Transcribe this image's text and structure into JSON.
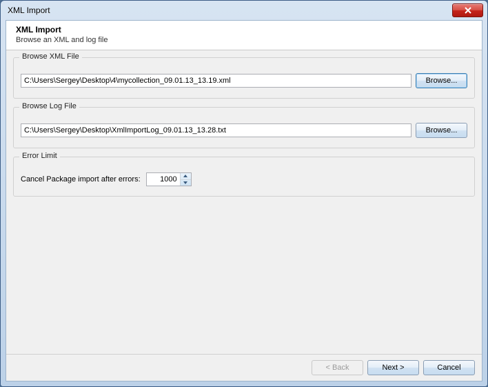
{
  "window": {
    "title": "XML Import"
  },
  "header": {
    "heading": "XML Import",
    "subtitle": "Browse an XML and log file"
  },
  "groups": {
    "xml": {
      "legend": "Browse XML File",
      "path": "C:\\Users\\Sergey\\Desktop\\4\\mycollection_09.01.13_13.19.xml",
      "browse_label": "Browse..."
    },
    "log": {
      "legend": "Browse Log File",
      "path": "C:\\Users\\Sergey\\Desktop\\XmlImportLog_09.01.13_13.28.txt",
      "browse_label": "Browse..."
    },
    "error": {
      "legend": "Error Limit",
      "label": "Cancel Package import after errors:",
      "value": "1000"
    }
  },
  "footer": {
    "back_label": "< Back",
    "next_label": "Next >",
    "cancel_label": "Cancel"
  }
}
